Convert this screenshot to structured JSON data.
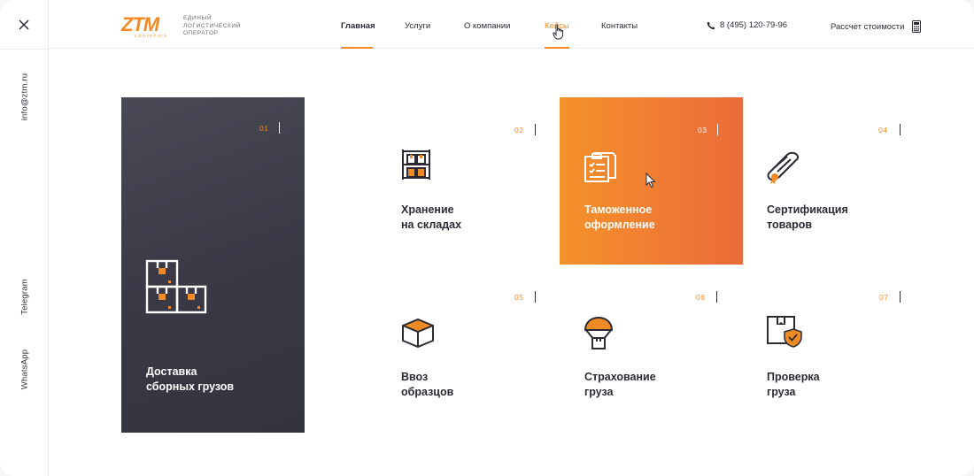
{
  "rail": {
    "email": "info@ztm.ru",
    "telegram": "Telegram",
    "whatsapp": "WhatsApp"
  },
  "logo": {
    "mark": "ZTM",
    "sub": "LOGISTICS",
    "line1": "ЕДИНЫЙ",
    "line2": "ЛОГИСТИЧЕСКИЙ",
    "line3": "ОПЕРАТОР"
  },
  "nav": {
    "items": [
      {
        "label": "Главная"
      },
      {
        "label": "Услуги"
      },
      {
        "label": "О компании"
      },
      {
        "label": "Кейсы"
      },
      {
        "label": "Контакты"
      }
    ]
  },
  "header": {
    "phone": "8 (495) 120-79-96",
    "calc_label": "Рассчет стоимости"
  },
  "cards": [
    {
      "num": "01",
      "title": "Доставка\nсборных грузов",
      "icon": "boxes-icon"
    },
    {
      "num": "02",
      "title": "Хранение\nна складах",
      "icon": "warehouse-shelf-icon"
    },
    {
      "num": "03",
      "title": "Таможенное\nоформление",
      "icon": "documents-checklist-icon"
    },
    {
      "num": "04",
      "title": "Сертификация\nтоваров",
      "icon": "certificate-scroll-icon"
    },
    {
      "num": "05",
      "title": "Ввоз\nобразцов",
      "icon": "box-icon"
    },
    {
      "num": "06",
      "title": "Страхование\nгруза",
      "icon": "parachute-cargo-icon"
    },
    {
      "num": "07",
      "title": "Проверка\nгруза",
      "icon": "box-shield-check-icon"
    }
  ],
  "colors": {
    "accent": "#f08a24",
    "dark": "#3c3c48",
    "text": "#2b2b36"
  }
}
